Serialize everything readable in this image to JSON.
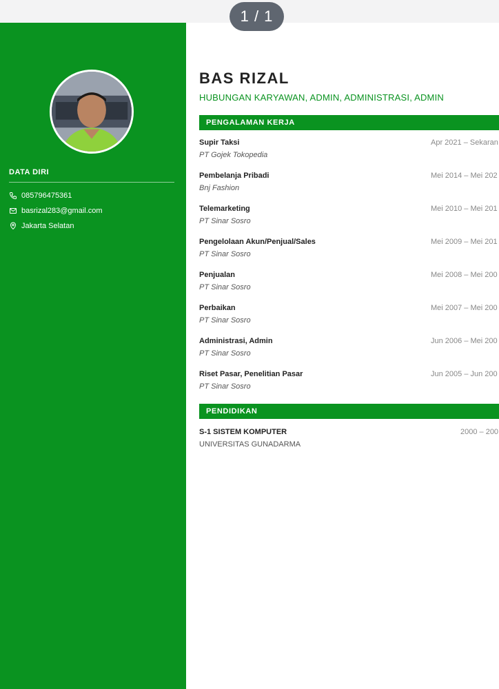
{
  "viewer": {
    "page_indicator": "1 / 1"
  },
  "profile": {
    "name": "BAS RIZAL",
    "headline": "HUBUNGAN KARYAWAN, ADMIN, ADMINISTRASI, ADMIN"
  },
  "sidebar": {
    "section_title": "DATA DIRI",
    "contacts": [
      {
        "icon": "phone-icon",
        "text": "085796475361"
      },
      {
        "icon": "mail-icon",
        "text": "basrizal283@gmail.com"
      },
      {
        "icon": "location-icon",
        "text": "Jakarta Selatan"
      }
    ]
  },
  "experience": {
    "title": "PENGALAMAN KERJA",
    "items": [
      {
        "role": "Supir Taksi",
        "company": "PT Gojek Tokopedia",
        "period": "Apr 2021 – Sekaran"
      },
      {
        "role": "Pembelanja Pribadi",
        "company": "Bnj Fashion",
        "period": "Mei 2014 – Mei 202"
      },
      {
        "role": "Telemarketing",
        "company": "PT Sinar Sosro",
        "period": "Mei 2010 – Mei 201"
      },
      {
        "role": "Pengelolaan Akun/Penjual/Sales",
        "company": "PT Sinar Sosro",
        "period": "Mei 2009 – Mei 201"
      },
      {
        "role": "Penjualan",
        "company": "PT Sinar Sosro",
        "period": "Mei 2008 – Mei 200"
      },
      {
        "role": "Perbaikan",
        "company": "PT Sinar Sosro",
        "period": "Mei 2007 – Mei 200"
      },
      {
        "role": "Administrasi, Admin",
        "company": "PT Sinar Sosro",
        "period": "Jun 2006 – Mei 200"
      },
      {
        "role": "Riset Pasar, Penelitian Pasar",
        "company": "PT Sinar Sosro",
        "period": "Jun 2005 – Jun 200"
      }
    ]
  },
  "education": {
    "title": "PENDIDIKAN",
    "items": [
      {
        "degree": "S-1 SISTEM KOMPUTER",
        "school": "UNIVERSITAS GUNADARMA",
        "period": "2000 – 200"
      }
    ]
  },
  "colors": {
    "accent": "#0a9320",
    "indicator": "#5f6670"
  }
}
